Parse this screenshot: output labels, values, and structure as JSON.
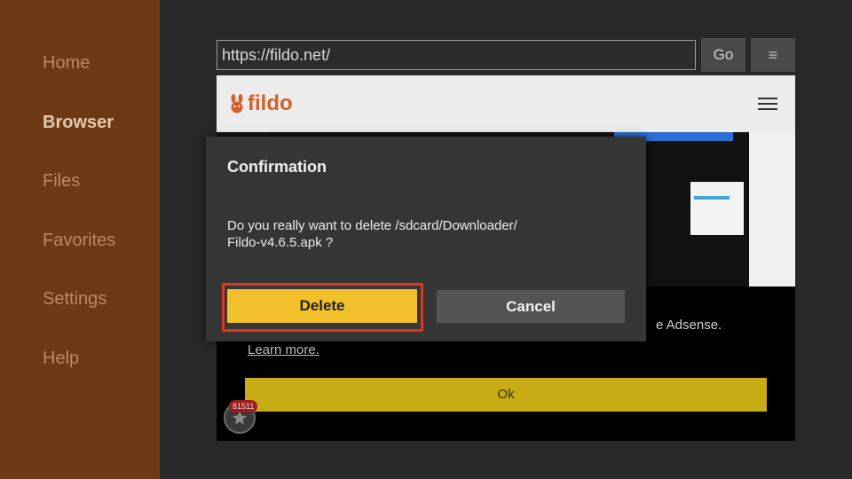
{
  "sidebar": {
    "items": [
      {
        "label": "Home",
        "active": false
      },
      {
        "label": "Browser",
        "active": true
      },
      {
        "label": "Files",
        "active": false
      },
      {
        "label": "Favorites",
        "active": false
      },
      {
        "label": "Settings",
        "active": false
      },
      {
        "label": "Help",
        "active": false
      }
    ]
  },
  "toolbar": {
    "url": "https://fildo.net/",
    "go_label": "Go",
    "menu_icon": "≡"
  },
  "webpage": {
    "logo_text": "fildo",
    "logo_icon": "rabbit-icon",
    "adsense_text": "e Adsense.",
    "learn_more": "Learn more.",
    "ok_label": "Ok",
    "badge_count": "81511"
  },
  "dialog": {
    "title": "Confirmation",
    "message_line1": "Do you really want to delete /sdcard/Downloader/",
    "message_line2": "Fildo-v4.6.5.apk ?",
    "delete_label": "Delete",
    "cancel_label": "Cancel"
  },
  "colors": {
    "sidebar_bg": "#6e3a13",
    "accent_yellow": "#f1c02a",
    "focus_red": "#e0361b",
    "fildo_orange": "#d3602a"
  }
}
